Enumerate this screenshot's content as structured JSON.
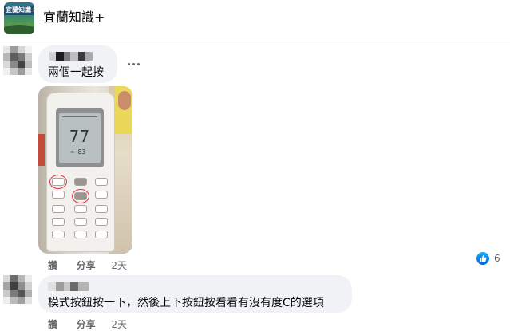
{
  "group": {
    "name": "宜蘭知識+",
    "avatar_text": "宜蘭知識+"
  },
  "comments": [
    {
      "text": "兩個一起按",
      "like_label": "讚",
      "share_label": "分享",
      "time": "2天",
      "reaction_count": "6",
      "attachment": {
        "lcd_temperature": "77",
        "lcd_fan": "♒ 83"
      }
    },
    {
      "text": "模式按鈕按一下，然後上下按鈕按看看有沒有度C的選項",
      "like_label": "讚",
      "share_label": "分享",
      "time": "2天"
    }
  ],
  "colors": {
    "bubble": "#f0f2f5",
    "meta_text": "#65676b",
    "like_blue": "#0866ff",
    "highlight_circle": "#d9364a"
  },
  "icons": {
    "more": "more-options-icon",
    "like": "like-reaction-icon"
  }
}
